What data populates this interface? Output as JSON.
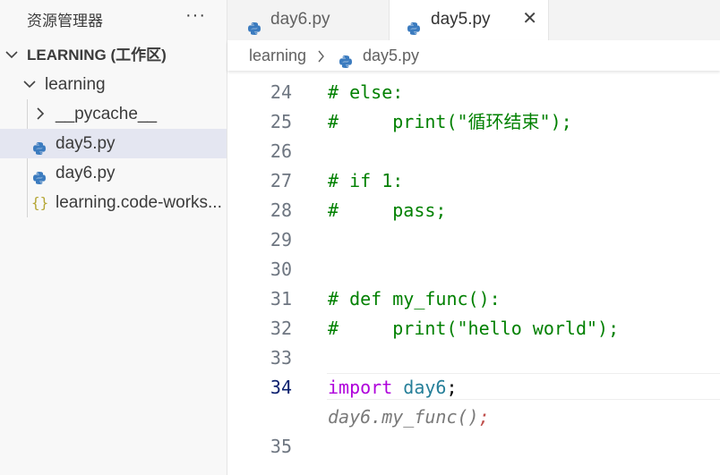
{
  "sidebar": {
    "title": "资源管理器",
    "more": "···",
    "workspace": "LEARNING (工作区)",
    "folder": "learning",
    "items": [
      {
        "label": "__pycache__",
        "type": "folder"
      },
      {
        "label": "day5.py",
        "type": "python",
        "selected": true
      },
      {
        "label": "day6.py",
        "type": "python"
      },
      {
        "label": "learning.code-works...",
        "type": "json"
      }
    ]
  },
  "tabs": [
    {
      "label": "day6.py",
      "active": false
    },
    {
      "label": "day5.py",
      "active": true,
      "close": "✕"
    }
  ],
  "breadcrumb": {
    "folder": "learning",
    "separator": "›",
    "file": "day5.py"
  },
  "editor": {
    "active_line": "34",
    "lines": [
      {
        "num": "24",
        "text": "# else:"
      },
      {
        "num": "25",
        "text": "#     print(\"循环结束\");"
      },
      {
        "num": "26",
        "text": ""
      },
      {
        "num": "27",
        "text": "# if 1:"
      },
      {
        "num": "28",
        "text": "#     pass;"
      },
      {
        "num": "29",
        "text": ""
      },
      {
        "num": "30",
        "text": ""
      },
      {
        "num": "31",
        "text": "# def my_func():"
      },
      {
        "num": "32",
        "text": "#     print(\"hello world\");"
      },
      {
        "num": "33",
        "text": ""
      },
      {
        "num": "34",
        "keyword": "import",
        "module": "day6",
        "punct": ";"
      },
      {
        "num": "35",
        "text": ""
      }
    ],
    "ghost_suggestion": {
      "text": "day6.my_func()",
      "semi": ";"
    }
  },
  "colors": {
    "comment": "#008000",
    "keyword": "#af00db",
    "module": "#267f99",
    "python_icon": "#3b7bbf",
    "json_icon": "#b5a636"
  }
}
